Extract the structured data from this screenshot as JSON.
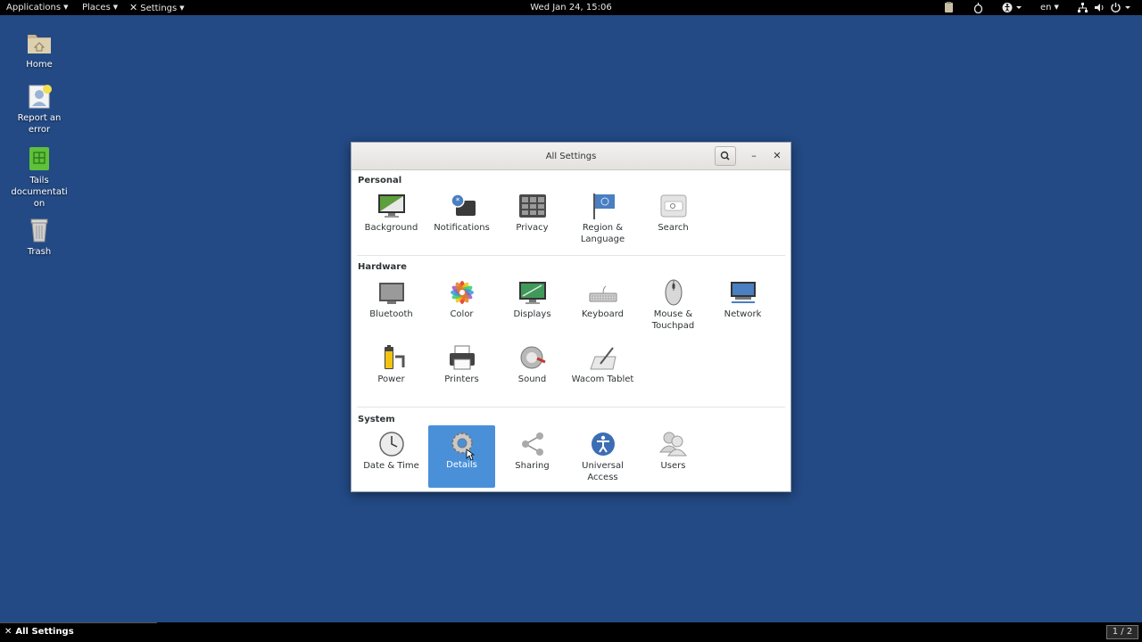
{
  "topbar": {
    "applications_label": "Applications",
    "places_label": "Places",
    "settings_label": "Settings",
    "clock": "Wed Jan 24, 15:06",
    "language": "en"
  },
  "desktop": {
    "icons": [
      {
        "label": "Home"
      },
      {
        "label": "Report an error"
      },
      {
        "label": "Tails documentation"
      },
      {
        "label": "Trash"
      }
    ]
  },
  "window": {
    "title": "All Settings",
    "sections": {
      "personal": {
        "title": "Personal",
        "items": [
          {
            "label": "Background"
          },
          {
            "label": "Notifications"
          },
          {
            "label": "Privacy"
          },
          {
            "label": "Region & Language"
          },
          {
            "label": "Search"
          }
        ]
      },
      "hardware": {
        "title": "Hardware",
        "items": [
          {
            "label": "Bluetooth"
          },
          {
            "label": "Color"
          },
          {
            "label": "Displays"
          },
          {
            "label": "Keyboard"
          },
          {
            "label": "Mouse & Touchpad"
          },
          {
            "label": "Network"
          },
          {
            "label": "Power"
          },
          {
            "label": "Printers"
          },
          {
            "label": "Sound"
          },
          {
            "label": "Wacom Tablet"
          }
        ]
      },
      "system": {
        "title": "System",
        "items": [
          {
            "label": "Date & Time"
          },
          {
            "label": "Details"
          },
          {
            "label": "Sharing"
          },
          {
            "label": "Universal Access"
          },
          {
            "label": "Users"
          }
        ]
      }
    },
    "selected_item": "Details"
  },
  "taskbar": {
    "task_label": "All Settings",
    "workspace": "1 / 2"
  },
  "colors": {
    "desktop_bg": "#234a85",
    "selection": "#4a90d9",
    "panel": "#000000"
  }
}
